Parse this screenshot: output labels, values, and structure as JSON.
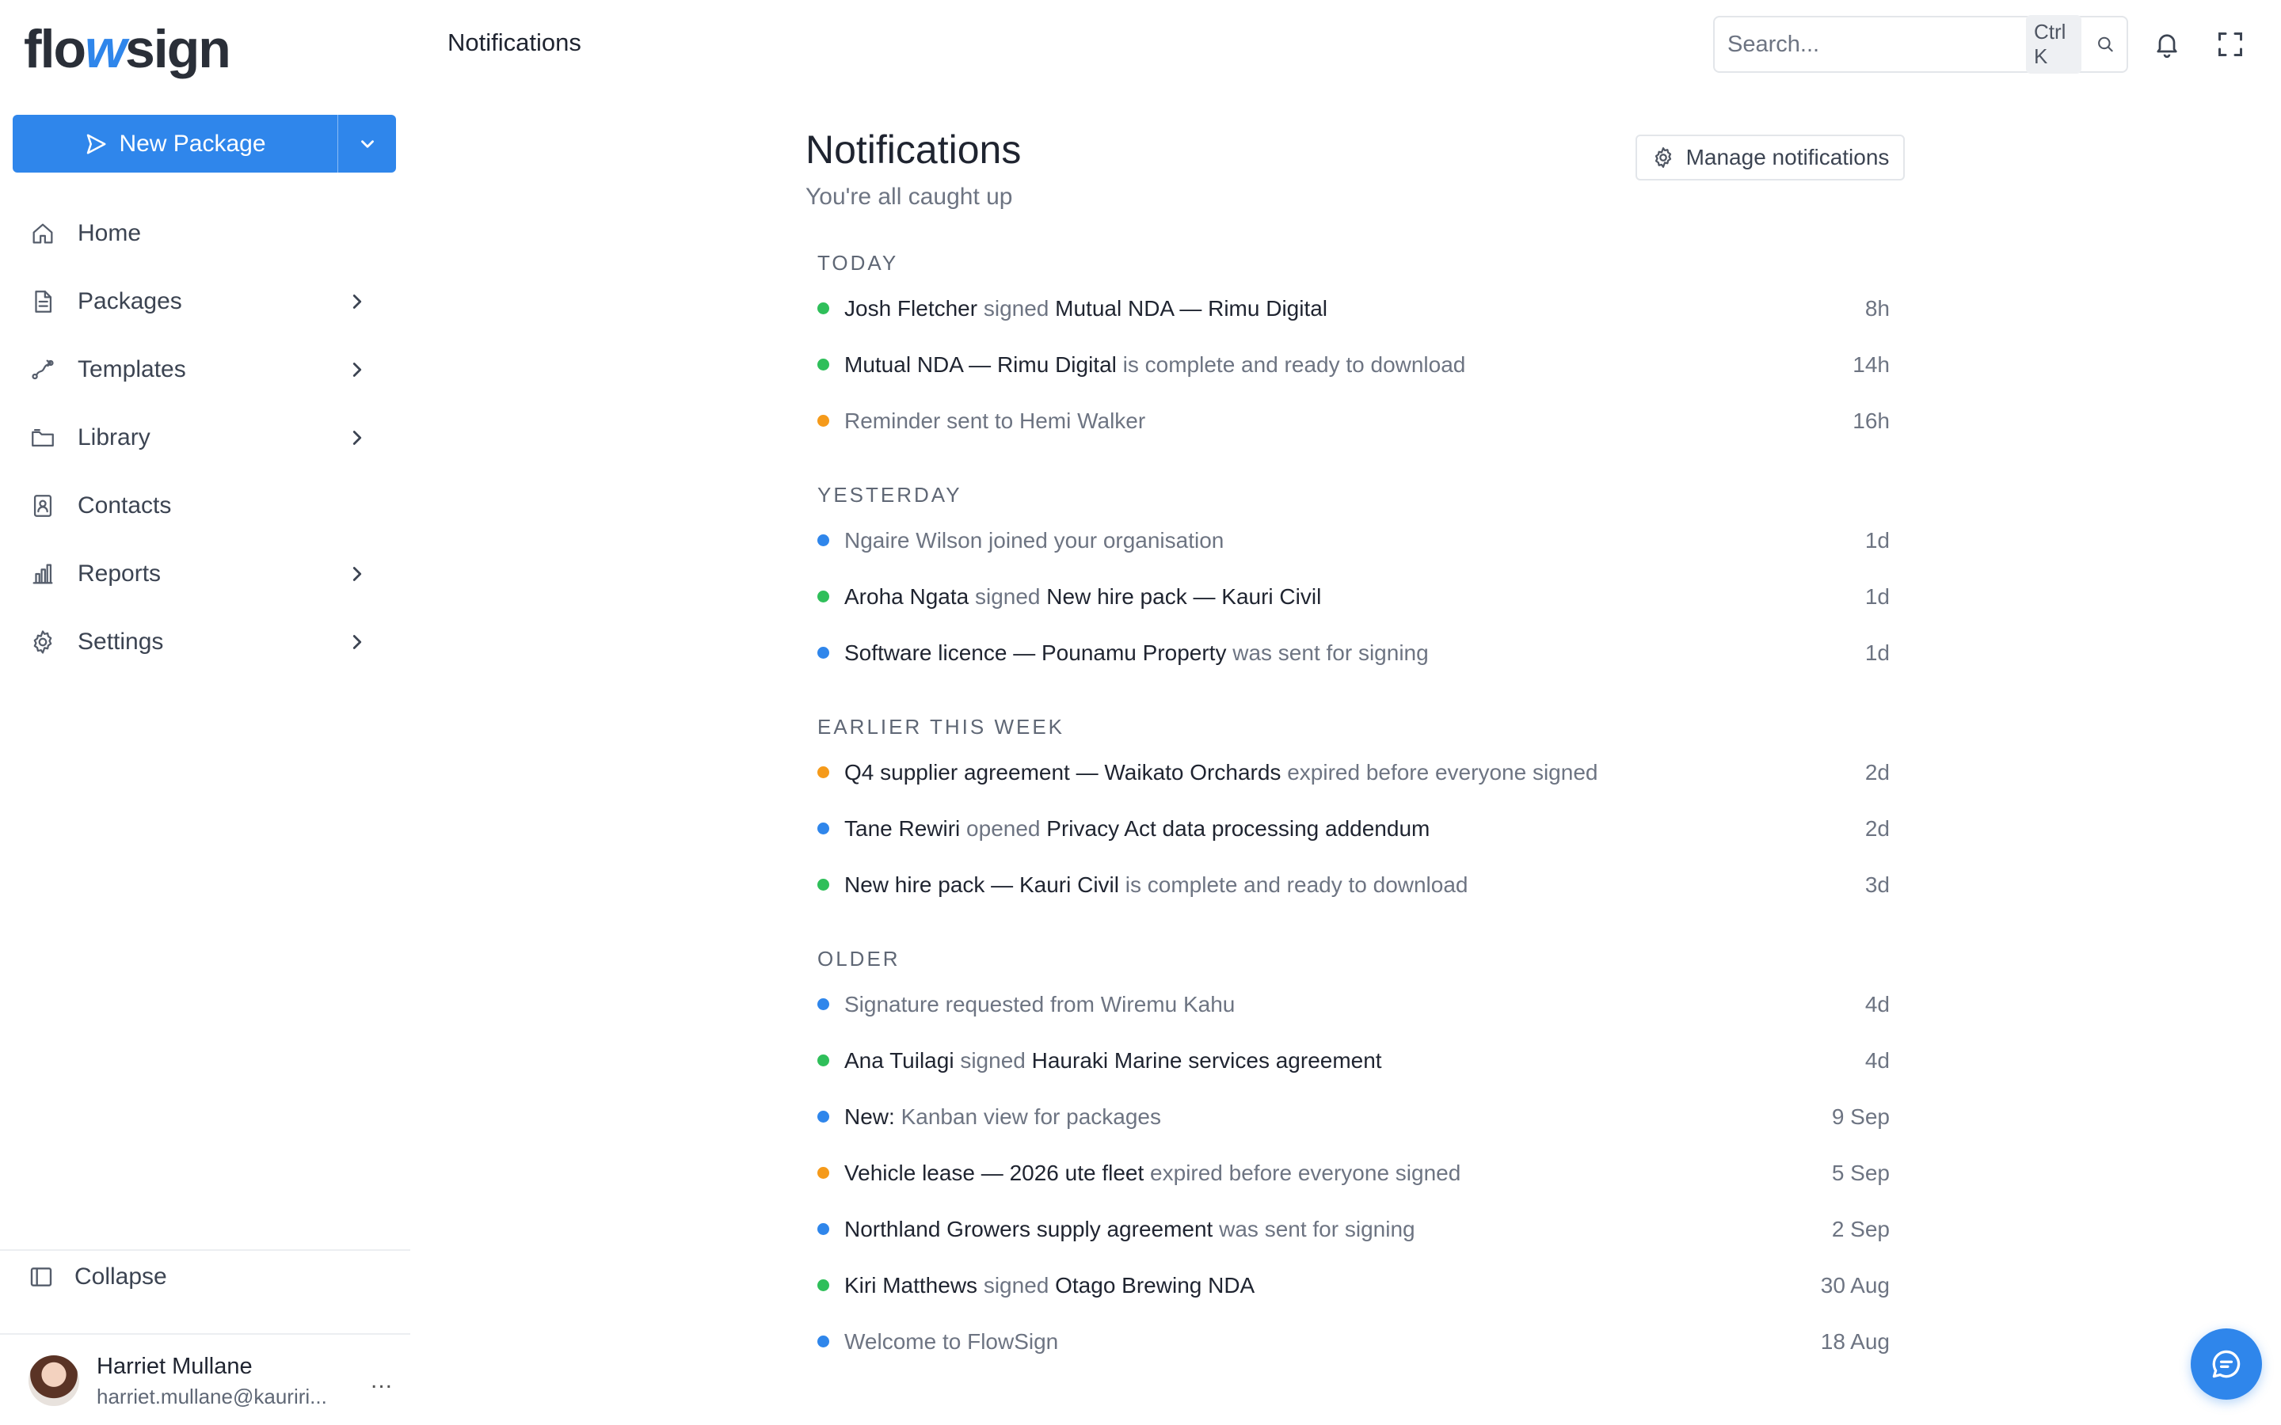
{
  "brand": {
    "part1": "flo",
    "part2": "w",
    "part3": "sign"
  },
  "sidebar": {
    "new_package_label": "New Package",
    "items": [
      {
        "label": "Home",
        "icon": "home-icon",
        "has_chevron": false
      },
      {
        "label": "Packages",
        "icon": "document-icon",
        "has_chevron": true
      },
      {
        "label": "Templates",
        "icon": "route-icon",
        "has_chevron": true
      },
      {
        "label": "Library",
        "icon": "folder-icon",
        "has_chevron": true
      },
      {
        "label": "Contacts",
        "icon": "contact-card-icon",
        "has_chevron": false
      },
      {
        "label": "Reports",
        "icon": "bar-chart-icon",
        "has_chevron": true
      },
      {
        "label": "Settings",
        "icon": "gear-icon",
        "has_chevron": true
      }
    ],
    "collapse_label": "Collapse",
    "user": {
      "name": "Harriet Mullane",
      "email": "harriet.mullane@kauriri...",
      "more": "..."
    }
  },
  "topbar": {
    "title": "Notifications",
    "search_placeholder": "Search...",
    "search_shortcut": "Ctrl K"
  },
  "main": {
    "title": "Notifications",
    "subtitle": "You're all caught up",
    "manage_label": "Manage notifications"
  },
  "colors": {
    "accent": "#2f86eb",
    "green": "#2fbf5a",
    "blue": "#2f86eb",
    "orange": "#f59a1a"
  },
  "sections": [
    {
      "title": "TODAY",
      "items": [
        {
          "dot": "green",
          "parts": [
            [
              "s",
              "Josh Fletcher"
            ],
            [
              "m",
              " signed "
            ],
            [
              "s",
              "Mutual NDA — Rimu Digital"
            ]
          ],
          "time": "8h"
        },
        {
          "dot": "green",
          "parts": [
            [
              "s",
              "Mutual NDA — Rimu Digital"
            ],
            [
              "m",
              " is complete and ready to download"
            ]
          ],
          "time": "14h"
        },
        {
          "dot": "orange",
          "parts": [
            [
              "m",
              "Reminder sent to Hemi Walker"
            ]
          ],
          "time": "16h"
        }
      ]
    },
    {
      "title": "YESTERDAY",
      "items": [
        {
          "dot": "blue",
          "parts": [
            [
              "m",
              "Ngaire Wilson joined your organisation"
            ]
          ],
          "time": "1d"
        },
        {
          "dot": "green",
          "parts": [
            [
              "s",
              "Aroha Ngata"
            ],
            [
              "m",
              " signed "
            ],
            [
              "s",
              "New hire pack — Kauri Civil"
            ]
          ],
          "time": "1d"
        },
        {
          "dot": "blue",
          "parts": [
            [
              "s",
              "Software licence — Pounamu Property"
            ],
            [
              "m",
              " was sent for signing"
            ]
          ],
          "time": "1d"
        }
      ]
    },
    {
      "title": "EARLIER THIS WEEK",
      "items": [
        {
          "dot": "orange",
          "parts": [
            [
              "s",
              "Q4 supplier agreement — Waikato Orchards"
            ],
            [
              "m",
              " expired before everyone signed"
            ]
          ],
          "time": "2d"
        },
        {
          "dot": "blue",
          "parts": [
            [
              "s",
              "Tane Rewiri"
            ],
            [
              "m",
              " opened "
            ],
            [
              "s",
              "Privacy Act data processing addendum"
            ]
          ],
          "time": "2d"
        },
        {
          "dot": "green",
          "parts": [
            [
              "s",
              "New hire pack — Kauri Civil"
            ],
            [
              "m",
              " is complete and ready to download"
            ]
          ],
          "time": "3d"
        }
      ]
    },
    {
      "title": "OLDER",
      "items": [
        {
          "dot": "blue",
          "parts": [
            [
              "m",
              "Signature requested from Wiremu Kahu"
            ]
          ],
          "time": "4d"
        },
        {
          "dot": "green",
          "parts": [
            [
              "s",
              "Ana Tuilagi"
            ],
            [
              "m",
              " signed "
            ],
            [
              "s",
              "Hauraki Marine services agreement"
            ]
          ],
          "time": "4d"
        },
        {
          "dot": "blue",
          "parts": [
            [
              "s",
              "New:"
            ],
            [
              "m",
              " Kanban view for packages"
            ]
          ],
          "time": "9 Sep"
        },
        {
          "dot": "orange",
          "parts": [
            [
              "s",
              "Vehicle lease — 2026 ute fleet"
            ],
            [
              "m",
              " expired before everyone signed"
            ]
          ],
          "time": "5 Sep"
        },
        {
          "dot": "blue",
          "parts": [
            [
              "s",
              "Northland Growers supply agreement"
            ],
            [
              "m",
              " was sent for signing"
            ]
          ],
          "time": "2 Sep"
        },
        {
          "dot": "green",
          "parts": [
            [
              "s",
              "Kiri Matthews"
            ],
            [
              "m",
              " signed "
            ],
            [
              "s",
              "Otago Brewing NDA"
            ]
          ],
          "time": "30 Aug"
        },
        {
          "dot": "blue",
          "parts": [
            [
              "m",
              "Welcome to FlowSign"
            ]
          ],
          "time": "18 Aug"
        }
      ]
    }
  ]
}
